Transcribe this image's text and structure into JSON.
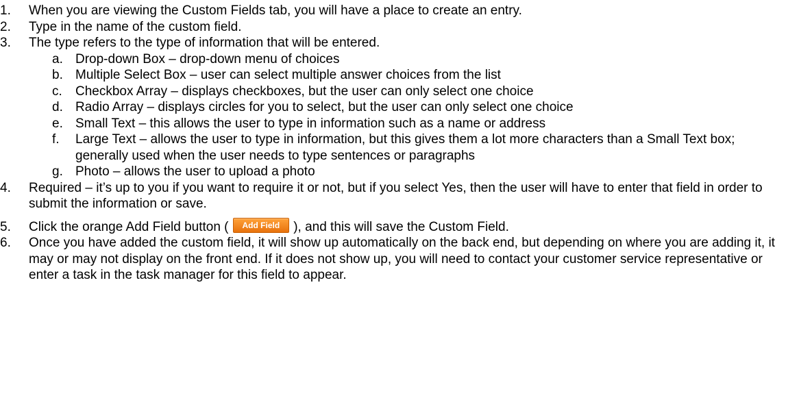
{
  "steps": [
    {
      "num": "1.",
      "text": "When you are viewing the Custom Fields tab, you will have a place to create an entry."
    },
    {
      "num": "2.",
      "text": "Type in the name of the custom field."
    },
    {
      "num": "3.",
      "text": "The type refers to the type of information that will be entered."
    },
    {
      "num": "4.",
      "text": "Required – it’s up to you if you want to require it or not, but if you select Yes, then the user will have to enter that field in order to submit the information or save."
    },
    {
      "num": "5.",
      "text_before": "Click the orange Add Field button (",
      "button_label": "Add Field",
      "text_after": "), and this will save the Custom Field."
    },
    {
      "num": "6.",
      "text": "Once you have added the custom field, it will show up automatically on the back end, but depending on where you are adding it, it may or may not display on the front end. If it does not show up, you will need to contact your customer service representative or enter a task in the task manager for this field to appear."
    }
  ],
  "types": [
    {
      "letter": "a.",
      "text": "Drop-down Box – drop-down menu of choices"
    },
    {
      "letter": "b.",
      "text": "Multiple Select Box – user can select multiple answer choices from the list"
    },
    {
      "letter": "c.",
      "text": "Checkbox Array – displays checkboxes, but the user can only select one choice"
    },
    {
      "letter": "d.",
      "text": "Radio Array – displays circles for you to select, but the user can only select one choice"
    },
    {
      "letter": "e.",
      "text": "Small Text – this allows the user to type in information such as a name or address"
    },
    {
      "letter": "f.",
      "text": "Large Text – allows the user to type in information, but this gives them a lot more characters than a Small Text box; generally used when the user needs to type sentences or paragraphs"
    },
    {
      "letter": "g.",
      "text": "Photo – allows the user to upload a photo"
    }
  ],
  "colors": {
    "button_orange": "#f08a1c",
    "text": "#000000"
  }
}
